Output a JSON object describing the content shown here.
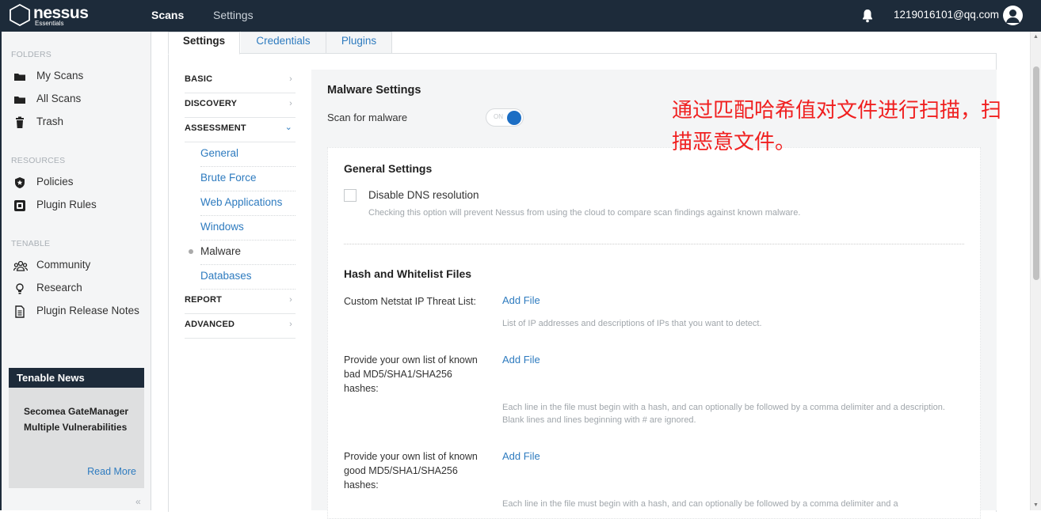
{
  "header": {
    "brand": "nessus",
    "brand_sub": "Essentials",
    "nav": {
      "scans": "Scans",
      "settings": "Settings"
    },
    "user_email": "1219016101@qq.com",
    "icons": {
      "notifications": "bell-icon",
      "user": "user-avatar-icon"
    }
  },
  "sidebar": {
    "folders_title": "FOLDERS",
    "folders": [
      {
        "label": "My Scans",
        "icon": "folder-icon"
      },
      {
        "label": "All Scans",
        "icon": "folder-icon"
      },
      {
        "label": "Trash",
        "icon": "trash-icon"
      }
    ],
    "resources_title": "RESOURCES",
    "resources": [
      {
        "label": "Policies",
        "icon": "shield-icon"
      },
      {
        "label": "Plugin Rules",
        "icon": "plugin-icon"
      }
    ],
    "tenable_title": "TENABLE",
    "tenable": [
      {
        "label": "Community",
        "icon": "community-icon"
      },
      {
        "label": "Research",
        "icon": "lightbulb-icon"
      },
      {
        "label": "Plugin Release Notes",
        "icon": "document-icon"
      }
    ],
    "news": {
      "title": "Tenable News",
      "headline": "Secomea GateManager Multiple Vulnerabilities",
      "read_more": "Read More"
    },
    "collapse": "«"
  },
  "tabs": {
    "settings": "Settings",
    "credentials": "Credentials",
    "plugins": "Plugins"
  },
  "subnav": {
    "basic": "BASIC",
    "discovery": "DISCOVERY",
    "assessment": "ASSESSMENT",
    "assessment_items": [
      "General",
      "Brute Force",
      "Web Applications",
      "Windows",
      "Malware",
      "Databases"
    ],
    "report": "REPORT",
    "advanced": "ADVANCED",
    "chev_right": "›",
    "chev_down": "⌄"
  },
  "malware": {
    "title": "Malware Settings",
    "scan_label": "Scan for malware",
    "toggle_text": "ON",
    "toggle_on": true,
    "general": {
      "title": "General Settings",
      "dns_label": "Disable DNS resolution",
      "dns_checked": false,
      "dns_help": "Checking this option will prevent Nessus from using the cloud to compare scan findings against known malware."
    },
    "hash": {
      "title": "Hash and Whitelist Files",
      "rows": [
        {
          "label": "Custom Netstat IP Threat List:",
          "action": "Add File",
          "help": "List of IP addresses and descriptions of IPs that you want to detect."
        },
        {
          "label": "Provide your own list of known bad MD5/SHA1/SHA256 hashes:",
          "action": "Add File",
          "help": "Each line in the file must begin with a hash, and can optionally be followed by a comma delimiter and a description. Blank lines and lines beginning with # are ignored."
        },
        {
          "label": "Provide your own list of known good MD5/SHA1/SHA256 hashes:",
          "action": "Add File",
          "help": "Each line in the file must begin with a hash, and can optionally be followed by a comma delimiter and a"
        }
      ]
    }
  },
  "annotation": "通过匹配哈希值对文件进行扫描，扫描恶意文件。",
  "colors": {
    "header_bg": "#1d2b3a",
    "link": "#2e7bbf",
    "toggle_on": "#1c6ec4",
    "annotation": "#f01f1f"
  }
}
